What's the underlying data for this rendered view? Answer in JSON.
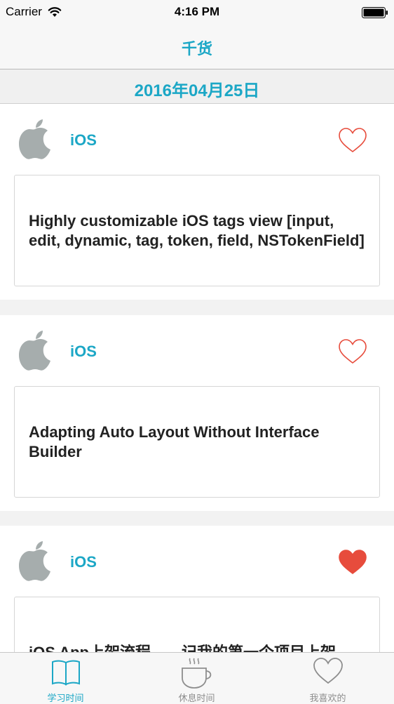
{
  "status_bar": {
    "carrier": "Carrier",
    "time": "4:16 PM",
    "wifi_icon": "wifi-icon",
    "battery_icon": "battery-icon"
  },
  "nav": {
    "title": "千货"
  },
  "date": "2016年04月25日",
  "colors": {
    "accent": "#1ca7c6",
    "heart": "#e74c3c",
    "icon_gray": "#a6adad"
  },
  "feed": [
    {
      "category": "iOS",
      "title": "Highly customizable iOS tags view [input, edit, dynamic, tag, token, field, NSTokenField]",
      "liked": false,
      "icon": "apple-icon"
    },
    {
      "category": "iOS",
      "title": "Adapting Auto Layout Without Interface Builder",
      "liked": false,
      "icon": "apple-icon"
    },
    {
      "category": "iOS",
      "title": "iOS App上架流程——记我的第一个项目上架",
      "liked": true,
      "icon": "apple-icon"
    }
  ],
  "tabs": [
    {
      "label": "学习时间",
      "icon": "book-icon",
      "active": true
    },
    {
      "label": "休息时间",
      "icon": "coffee-icon",
      "active": false
    },
    {
      "label": "我喜欢的",
      "icon": "heart-icon",
      "active": false
    }
  ]
}
